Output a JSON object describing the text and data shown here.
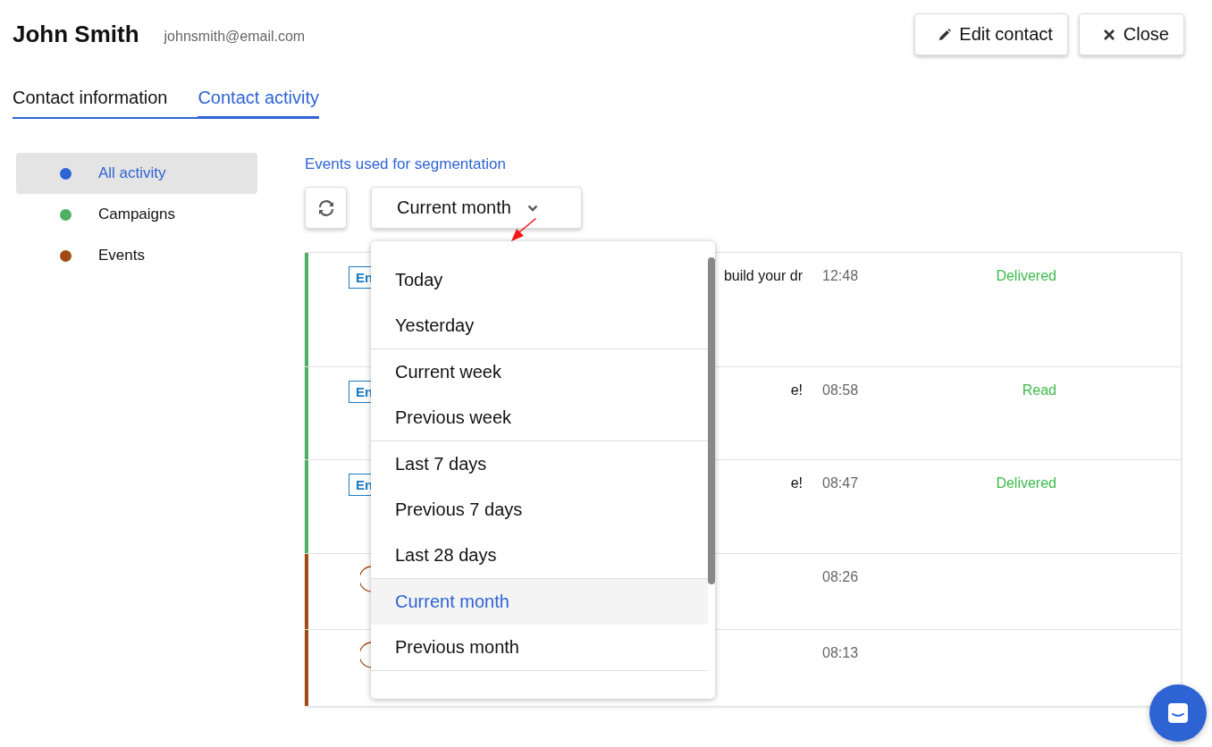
{
  "contact": {
    "name": "John Smith",
    "email": "johnsmith@email.com"
  },
  "actions": [
    {
      "kind": "edit",
      "label": "Edit contact"
    },
    {
      "kind": "close",
      "label": "Close"
    }
  ],
  "tabs": [
    {
      "label": "Contact information",
      "selected": false
    },
    {
      "label": "Contact activity",
      "selected": true
    }
  ],
  "sidebar": {
    "items": [
      {
        "label": "All activity",
        "color": "#2e63d4",
        "selected": true
      },
      {
        "label": "Campaigns",
        "color": "#4caf62",
        "selected": false
      },
      {
        "label": "Events",
        "color": "#a04a14",
        "selected": false
      }
    ]
  },
  "segmentation_link": "Events used for segmentation",
  "period_select": {
    "value": "Current month",
    "expanded": true,
    "groups": [
      [
        {
          "label": "Today",
          "selected": false
        },
        {
          "label": "Yesterday",
          "selected": false
        }
      ],
      [
        {
          "label": "Current week",
          "selected": false
        },
        {
          "label": "Previous week",
          "selected": false
        }
      ],
      [
        {
          "label": "Last 7 days",
          "selected": false
        },
        {
          "label": "Previous 7 days",
          "selected": false
        },
        {
          "label": "Last 28 days",
          "selected": false
        }
      ],
      [
        {
          "label": "Current month",
          "selected": true
        },
        {
          "label": "Previous month",
          "selected": false
        }
      ]
    ]
  },
  "activity": [
    {
      "kind": "email",
      "color": "#4caf62",
      "tag": "En",
      "subject": "build your dr",
      "time": "12:48",
      "status": "Delivered"
    },
    {
      "kind": "email",
      "color": "#4caf62",
      "tag": "En",
      "subject": "e!",
      "time": "08:58",
      "status": "Read"
    },
    {
      "kind": "email",
      "color": "#4caf62",
      "tag": "En",
      "subject": "e!",
      "time": "08:47",
      "status": "Delivered"
    },
    {
      "kind": "event",
      "color": "#a04a14",
      "time": "08:26"
    },
    {
      "kind": "event",
      "color": "#a04a14",
      "time": "08:13"
    }
  ]
}
